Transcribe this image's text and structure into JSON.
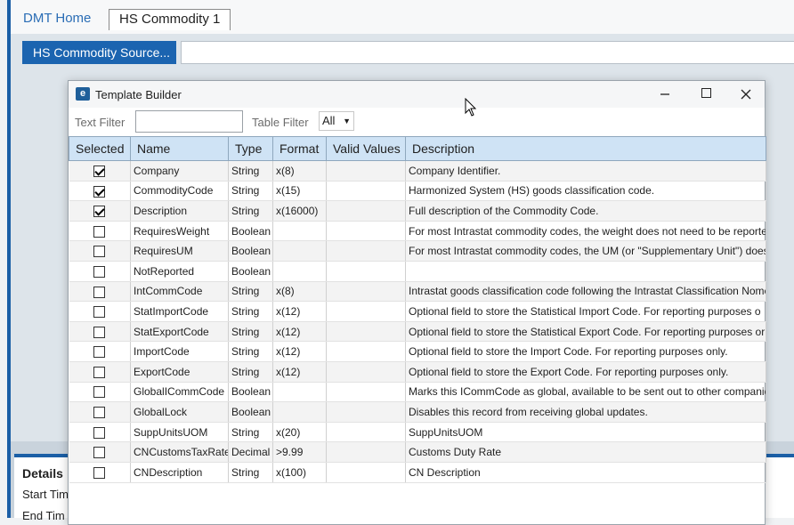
{
  "app": {
    "tabs": [
      {
        "label": "DMT Home"
      },
      {
        "label": "HS Commodity 1"
      }
    ],
    "source_button": "HS Commodity Source...",
    "details": {
      "title": "Details",
      "start_label": "Start Tim",
      "end_label": "End Tim"
    }
  },
  "dialog": {
    "title": "Template Builder",
    "icon": "app-logo-icon",
    "controls": {
      "minimize": "minimize-icon",
      "maximize": "maximize-icon",
      "close": "close-icon"
    },
    "filters": {
      "text_filter_label": "Text Filter",
      "text_filter_value": "",
      "table_filter_label": "Table Filter",
      "table_filter_value": "All"
    },
    "columns": [
      "Selected",
      "Name",
      "Type",
      "Format",
      "Valid Values",
      "Description"
    ],
    "rows": [
      {
        "selected": true,
        "name": "Company",
        "type": "String",
        "format": "x(8)",
        "valid": "",
        "description": "Company Identifier."
      },
      {
        "selected": true,
        "name": "CommodityCode",
        "type": "String",
        "format": "x(15)",
        "valid": "",
        "description": "Harmonized System (HS) goods classification code."
      },
      {
        "selected": true,
        "name": "Description",
        "type": "String",
        "format": "x(16000)",
        "valid": "",
        "description": "Full description of the Commodity Code."
      },
      {
        "selected": false,
        "name": "RequiresWeight",
        "type": "Boolean",
        "format": "",
        "valid": "",
        "description": "For most Intrastat commodity codes, the weight does not need to be reporte"
      },
      {
        "selected": false,
        "name": "RequiresUM",
        "type": "Boolean",
        "format": "",
        "valid": "",
        "description": "For most Intrastat commodity codes, the UM (or \"Supplementary Unit\") does"
      },
      {
        "selected": false,
        "name": "NotReported",
        "type": "Boolean",
        "format": "",
        "valid": "",
        "description": ""
      },
      {
        "selected": false,
        "name": "IntCommCode",
        "type": "String",
        "format": "x(8)",
        "valid": "",
        "description": "Intrastat goods classification code following the Intrastat Classification Nome"
      },
      {
        "selected": false,
        "name": "StatImportCode",
        "type": "String",
        "format": "x(12)",
        "valid": "",
        "description": "Optional field to store the Statistical Import Code.  For reporting purposes o"
      },
      {
        "selected": false,
        "name": "StatExportCode",
        "type": "String",
        "format": "x(12)",
        "valid": "",
        "description": "Optional field to store the Statistical Export Code.  For reporting purposes or"
      },
      {
        "selected": false,
        "name": "ImportCode",
        "type": "String",
        "format": "x(12)",
        "valid": "",
        "description": "Optional field to store the Import Code.  For reporting purposes only."
      },
      {
        "selected": false,
        "name": "ExportCode",
        "type": "String",
        "format": "x(12)",
        "valid": "",
        "description": "Optional field to store the Export Code.  For reporting purposes only."
      },
      {
        "selected": false,
        "name": "GlobalICommCode",
        "type": "Boolean",
        "format": "",
        "valid": "",
        "description": "Marks this ICommCode as global, available to be sent out to other companie"
      },
      {
        "selected": false,
        "name": "GlobalLock",
        "type": "Boolean",
        "format": "",
        "valid": "",
        "description": "Disables this record from receiving global updates."
      },
      {
        "selected": false,
        "name": "SuppUnitsUOM",
        "type": "String",
        "format": "x(20)",
        "valid": "",
        "description": "SuppUnitsUOM"
      },
      {
        "selected": false,
        "name": "CNCustomsTaxRate",
        "type": "Decimal",
        "format": ">9.99",
        "valid": "",
        "description": "Customs Duty Rate"
      },
      {
        "selected": false,
        "name": "CNDescription",
        "type": "String",
        "format": "x(100)",
        "valid": "",
        "description": "CN Description"
      }
    ]
  },
  "colors": {
    "accent": "#1b64b0",
    "header_bg": "#cfe3f5",
    "app_bg": "#dde4ea"
  }
}
